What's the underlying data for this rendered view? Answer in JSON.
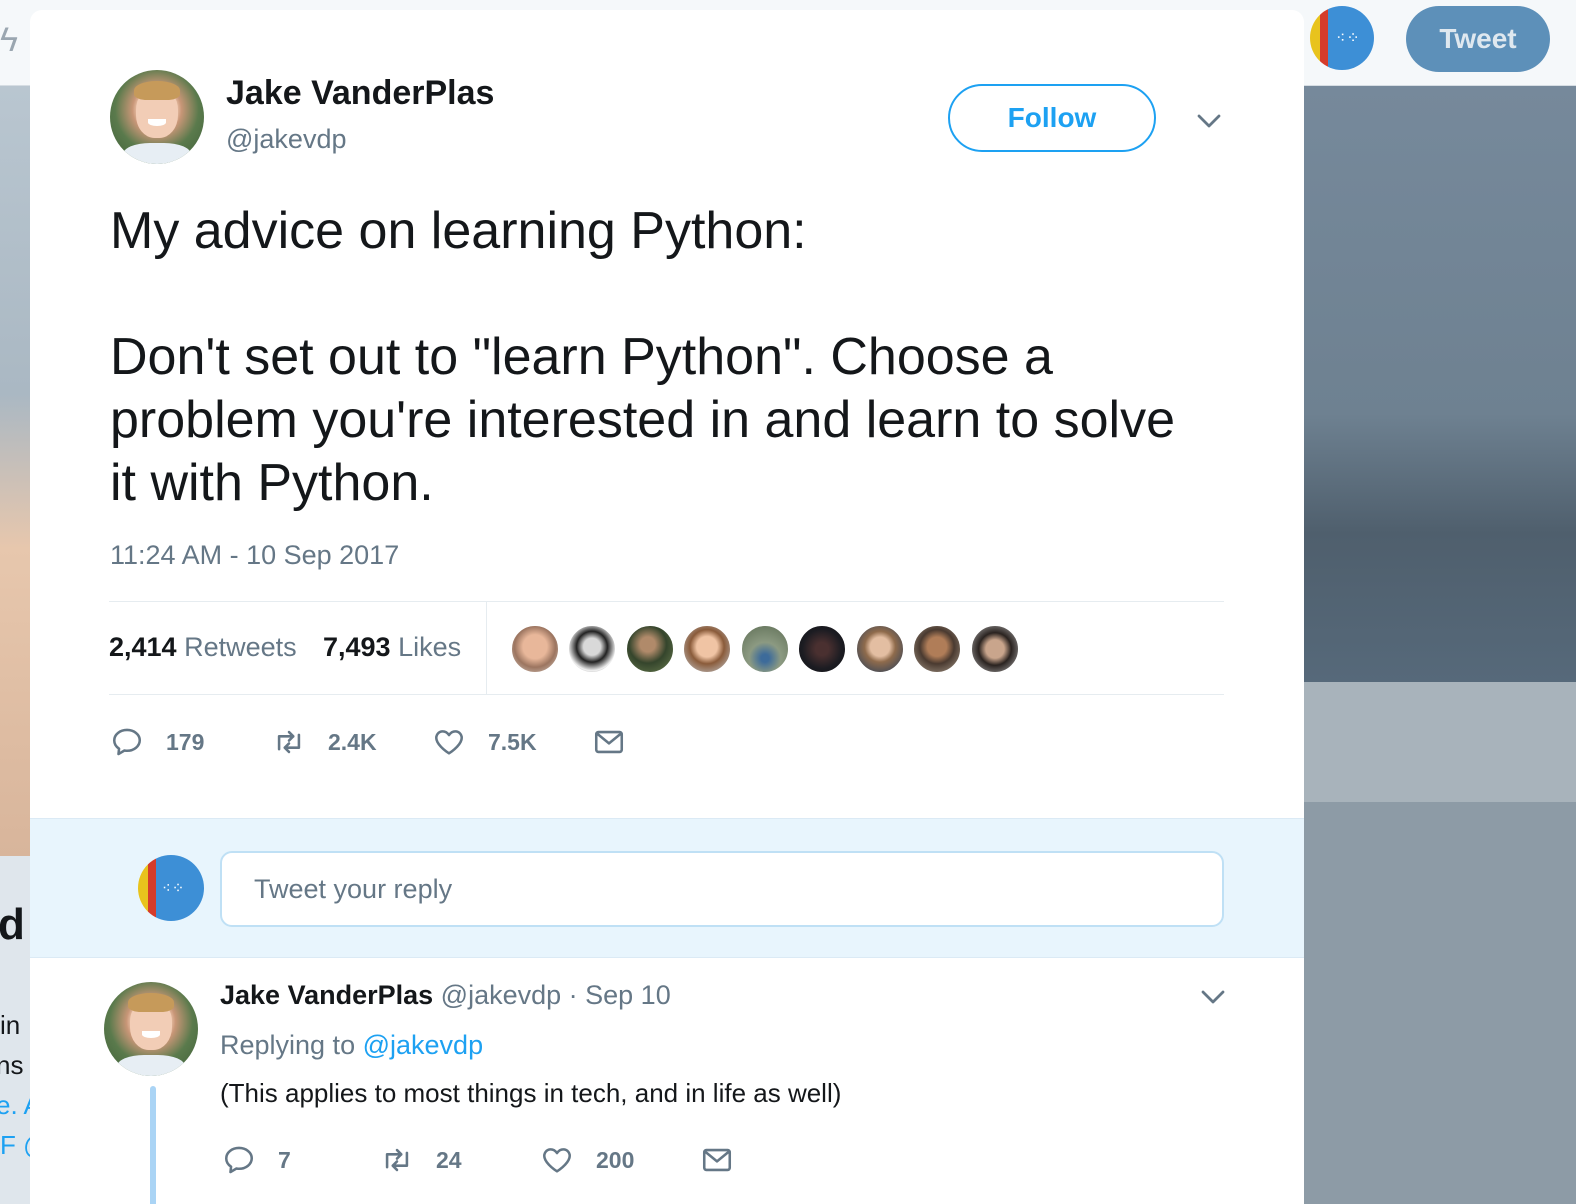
{
  "background": {
    "tweet_button_label": "Tweet",
    "left_text_fragments": [
      "d",
      "in",
      "ns",
      "e. A",
      "F @"
    ]
  },
  "tweet": {
    "author_name": "Jake VanderPlas",
    "author_handle": "@jakevdp",
    "follow_label": "Follow",
    "text": "My advice on learning Python:\n\nDon't set out to \"learn Python\". Choose a problem you're interested in and learn to solve it with Python.",
    "timestamp": "11:24 AM - 10 Sep 2017",
    "retweets_count": "2,414",
    "retweets_label": "Retweets",
    "likes_count": "7,493",
    "likes_label": "Likes",
    "likers_count_shown": 9,
    "actions": {
      "replies": "179",
      "retweets": "2.4K",
      "likes": "7.5K"
    }
  },
  "reply_box": {
    "placeholder": "Tweet your reply"
  },
  "reply": {
    "author_name": "Jake VanderPlas",
    "meta": "@jakevdp · Sep 10",
    "replying_prefix": "Replying to",
    "replying_handle": "@jakevdp",
    "text": "(This applies to most things in tech, and in life as well)",
    "actions": {
      "replies": "7",
      "retweets": "24",
      "likes": "200"
    }
  },
  "colors": {
    "accent": "#1da1f2",
    "secondary_text": "#657786",
    "primary_text": "#14171a",
    "reply_area_bg": "#e8f5fd"
  }
}
